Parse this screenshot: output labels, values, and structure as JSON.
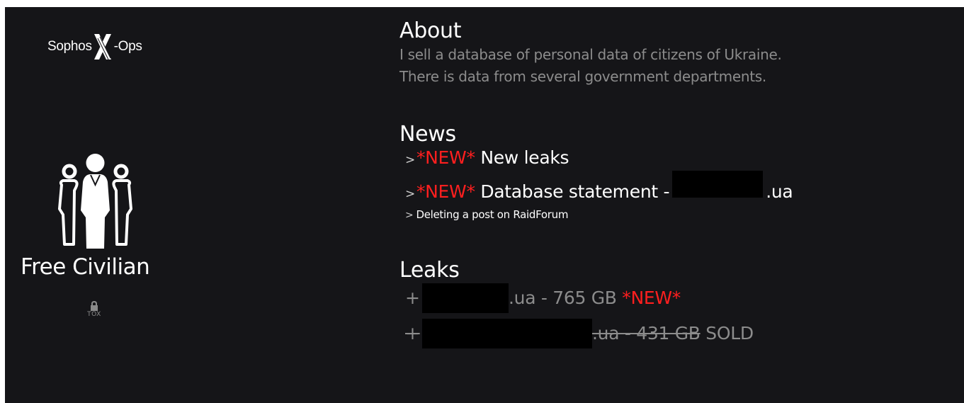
{
  "brand": {
    "left_text": "Sophos",
    "right_text": "-Ops",
    "mark_icon": "x-mark-icon"
  },
  "sidebar": {
    "group_icon": "group-people-icon",
    "site_name": "Free Civilian",
    "tox_label": "TOX",
    "tox_icon": "lock-icon"
  },
  "about": {
    "title": "About",
    "lines": [
      "I sell a database of personal data of citizens of Ukraine.",
      "There is data from several government departments."
    ]
  },
  "news": {
    "title": "News",
    "items": [
      {
        "arrow": ">",
        "tag": "*NEW*",
        "text": " New leaks"
      },
      {
        "arrow": ">",
        "tag": "*NEW*",
        "text": " Database statement -",
        "suffix": ".ua"
      },
      {
        "arrow": ">",
        "text": "Deleting a post on RaidForum"
      }
    ]
  },
  "leaks": {
    "title": "Leaks",
    "items": [
      {
        "prefix": "+",
        "text": ".ua - 765 GB ",
        "tag": "*NEW*"
      },
      {
        "prefix": "+",
        "struck_text": ".ua - 431 GB",
        "status": " SOLD"
      }
    ]
  },
  "colors": {
    "background": "#151518",
    "accent_new": "#ff1f1f",
    "muted_text": "#8c8c8c"
  }
}
